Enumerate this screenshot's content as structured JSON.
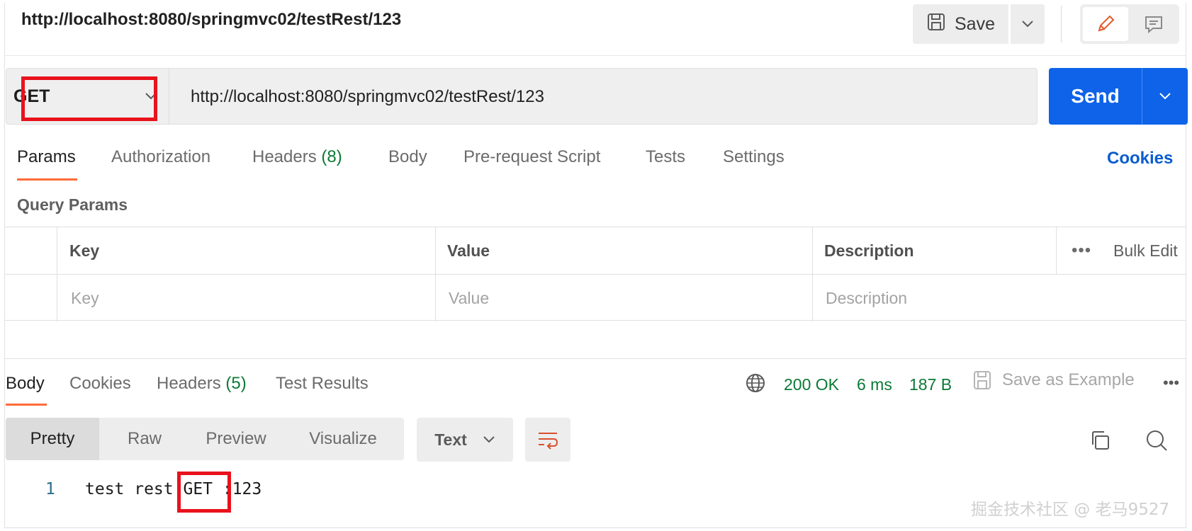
{
  "request": {
    "title": "http://localhost:8080/springmvc02/testRest/123",
    "method": "GET",
    "url": "http://localhost:8080/springmvc02/testRest/123",
    "save_label": "Save",
    "send_label": "Send"
  },
  "request_tabs": {
    "params": "Params",
    "authorization": "Authorization",
    "headers": "Headers",
    "headers_count": "(8)",
    "body": "Body",
    "pre_request": "Pre-request Script",
    "tests": "Tests",
    "settings": "Settings",
    "cookies": "Cookies"
  },
  "query_params": {
    "title": "Query Params",
    "columns": {
      "key": "Key",
      "value": "Value",
      "description": "Description"
    },
    "more": "•••",
    "bulk_edit": "Bulk Edit",
    "placeholders": {
      "key": "Key",
      "value": "Value",
      "description": "Description"
    }
  },
  "response_tabs": {
    "body": "Body",
    "cookies": "Cookies",
    "headers": "Headers",
    "headers_count": "(5)",
    "test_results": "Test Results"
  },
  "response_status": {
    "code": "200 OK",
    "time": "6 ms",
    "size": "187 B",
    "save_as_example": "Save as Example",
    "more": "•••"
  },
  "format": {
    "pretty": "Pretty",
    "raw": "Raw",
    "preview": "Preview",
    "visualize": "Visualize",
    "type": "Text"
  },
  "response_body": {
    "line_number": "1",
    "content": "test rest GET :123"
  },
  "watermark": "掘金技术社区 @ 老马9527",
  "colors": {
    "accent_orange": "#ff6c37",
    "send_blue": "#0e63e8",
    "status_green": "#0b7a35",
    "highlight_red": "#e8121c",
    "link_blue": "#0b5cce"
  }
}
